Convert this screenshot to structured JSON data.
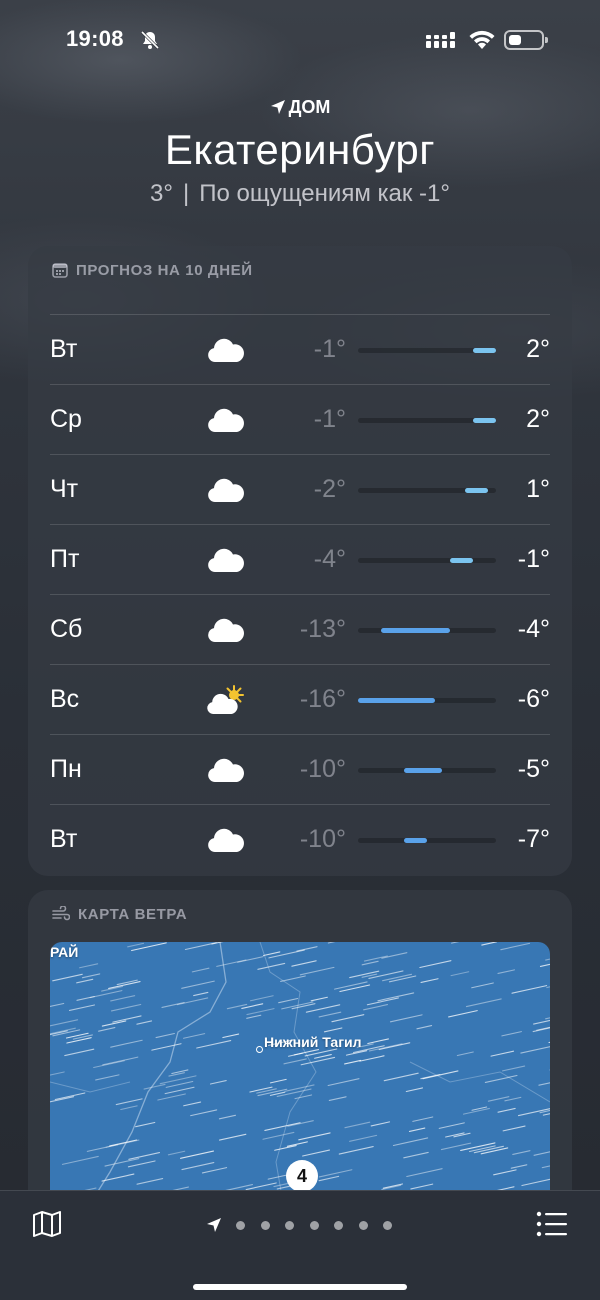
{
  "status_bar": {
    "time": "19:08",
    "icons": [
      "bell-slash-icon",
      "cellular-signal-icon",
      "wifi-icon",
      "battery-icon"
    ]
  },
  "header": {
    "location_label": "ДОМ",
    "city": "Екатеринбург",
    "current_temp": "3°",
    "separator": "|",
    "feels_like": "По ощущениям как -1°"
  },
  "forecast": {
    "title": "ПРОГНОЗ НА 10 ДНЕЙ",
    "icon": "calendar-icon",
    "range_min": -16,
    "range_max": 2,
    "days": [
      {
        "day": "Вт",
        "icon": "cloud-icon",
        "min": "-1°",
        "max": "2°",
        "lo": -1,
        "hi": 2
      },
      {
        "day": "Ср",
        "icon": "cloud-icon",
        "min": "-1°",
        "max": "2°",
        "lo": -1,
        "hi": 2
      },
      {
        "day": "Чт",
        "icon": "cloud-icon",
        "min": "-2°",
        "max": "1°",
        "lo": -2,
        "hi": 1
      },
      {
        "day": "Пт",
        "icon": "cloud-icon",
        "min": "-4°",
        "max": "-1°",
        "lo": -4,
        "hi": -1
      },
      {
        "day": "Сб",
        "icon": "cloud-icon",
        "min": "-13°",
        "max": "-4°",
        "lo": -13,
        "hi": -4
      },
      {
        "day": "Вс",
        "icon": "cloud-sun-icon",
        "min": "-16°",
        "max": "-6°",
        "lo": -16,
        "hi": -6
      },
      {
        "day": "Пн",
        "icon": "cloud-icon",
        "min": "-10°",
        "max": "-5°",
        "lo": -10,
        "hi": -5
      },
      {
        "day": "Вт",
        "icon": "cloud-icon",
        "min": "-10°",
        "max": "-7°",
        "lo": -10,
        "hi": -7
      }
    ]
  },
  "wind_map": {
    "title": "КАРТА ВЕТРА",
    "icon": "wind-icon",
    "edge_label": "РАЙ",
    "city_label": "Нижний Тагил",
    "badge": "4"
  },
  "bottom_bar": {
    "map_icon": "map-icon",
    "list_icon": "list-icon",
    "page_count": 7,
    "current_page": 0
  }
}
